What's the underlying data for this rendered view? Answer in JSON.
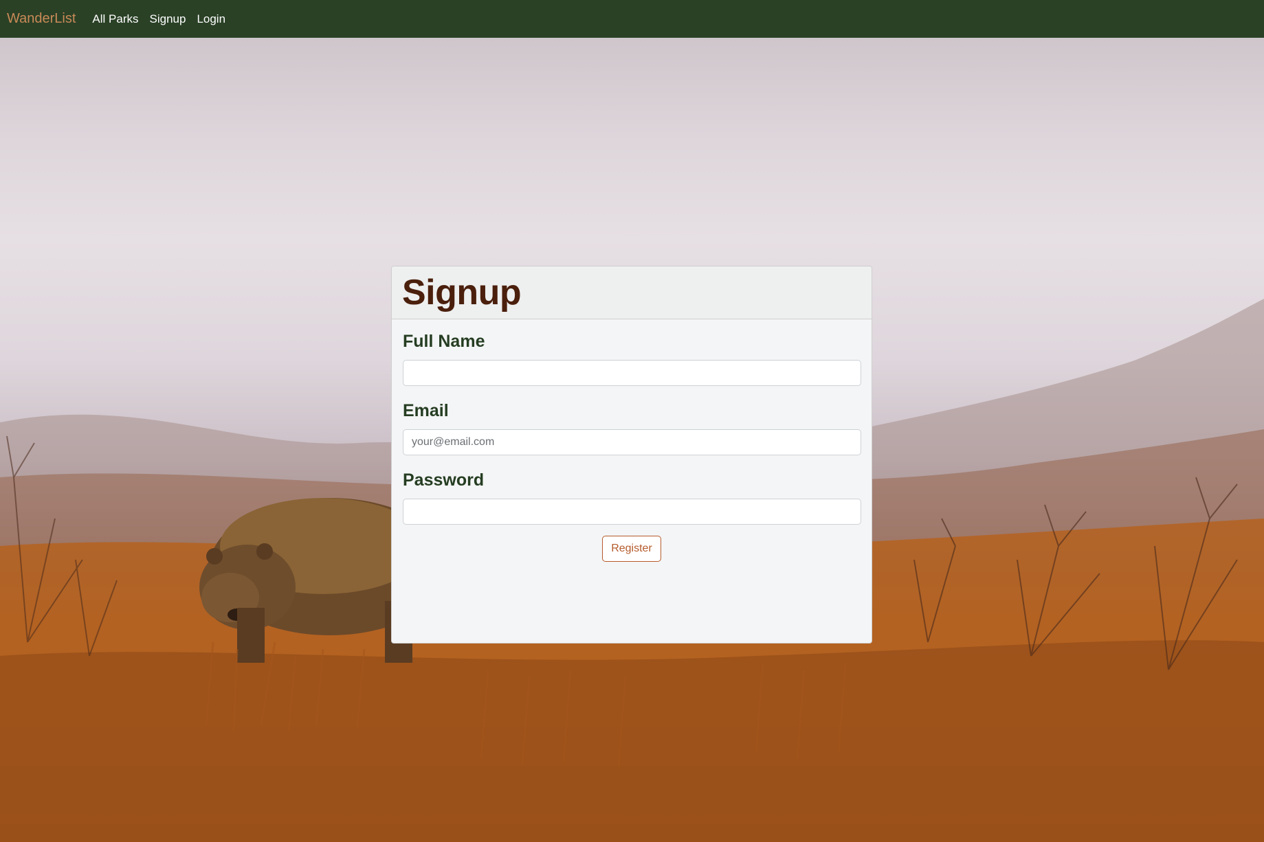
{
  "navbar": {
    "brand": "WanderList",
    "links": [
      "All Parks",
      "Signup",
      "Login"
    ]
  },
  "form": {
    "title": "Signup",
    "fields": [
      {
        "label": "Full Name",
        "value": "",
        "placeholder": ""
      },
      {
        "label": "Email",
        "value": "",
        "placeholder": "your@email.com"
      },
      {
        "label": "Password",
        "value": "",
        "placeholder": ""
      }
    ],
    "submit_label": "Register"
  },
  "colors": {
    "navbar_bg": "#2a4126",
    "brand": "#c98a57",
    "title": "#4a1f0c",
    "label": "#253d22",
    "button_accent": "#b55a2a"
  }
}
